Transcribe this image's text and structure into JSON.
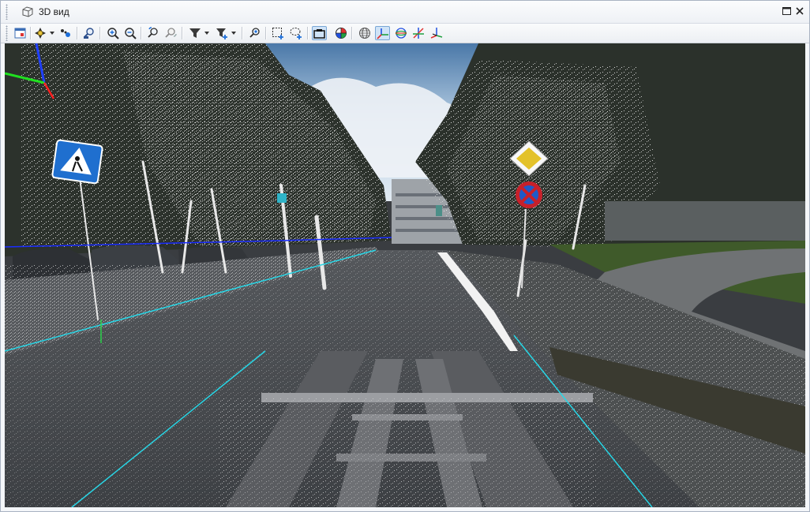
{
  "window": {
    "title": "3D вид",
    "title_icon": "cube-view-icon",
    "controls": [
      "maximize-icon",
      "close-icon"
    ]
  },
  "toolbar": {
    "buttons": [
      {
        "name": "frame-view-button",
        "icon": "frame-view-icon"
      },
      {
        "name": "pan-compass-button",
        "icon": "compass-arrows-icon",
        "has_dropdown": true
      },
      {
        "name": "points-button",
        "icon": "points-icon"
      },
      {
        "name": "find-person-button",
        "icon": "person-search-icon"
      },
      {
        "name": "zoom-in-button",
        "icon": "zoom-in-icon"
      },
      {
        "name": "zoom-out-button",
        "icon": "zoom-out-icon"
      },
      {
        "name": "rotate-left-button",
        "icon": "rotate-left-icon"
      },
      {
        "name": "rotate-right-button",
        "icon": "rotate-right-icon"
      },
      {
        "name": "filter-button",
        "icon": "filter-icon",
        "has_dropdown": true
      },
      {
        "name": "filter-add-button",
        "icon": "filter-add-icon",
        "has_dropdown": true
      },
      {
        "name": "select-point-button",
        "icon": "select-point-icon"
      },
      {
        "name": "rect-select-button",
        "icon": "rect-select-icon"
      },
      {
        "name": "lasso-select-button",
        "icon": "lasso-select-icon"
      },
      {
        "name": "camera-view-button",
        "icon": "camera-icon",
        "active": true
      },
      {
        "name": "colorize-button",
        "icon": "color-sphere-icon"
      },
      {
        "name": "grid-sphere-button",
        "icon": "grid-sphere-icon"
      },
      {
        "name": "axes-button",
        "icon": "axes-icon",
        "active": true
      },
      {
        "name": "orbit-button",
        "icon": "orbit-icon"
      },
      {
        "name": "cross-axes-button",
        "icon": "cross-axes-icon"
      },
      {
        "name": "axes-alt-button",
        "icon": "axes-alt-icon"
      }
    ]
  },
  "viewport": {
    "name": "3d-point-cloud-view",
    "colors": {
      "sky": "#cfe0f0",
      "road": "#4b4e52",
      "points": "#e8e8e8",
      "trajectory_blue": "#1a2cff",
      "trajectory_cyan": "#27d6e6",
      "axis_x": "#ff2020",
      "axis_y": "#20e020",
      "axis_z": "#2040ff"
    }
  }
}
